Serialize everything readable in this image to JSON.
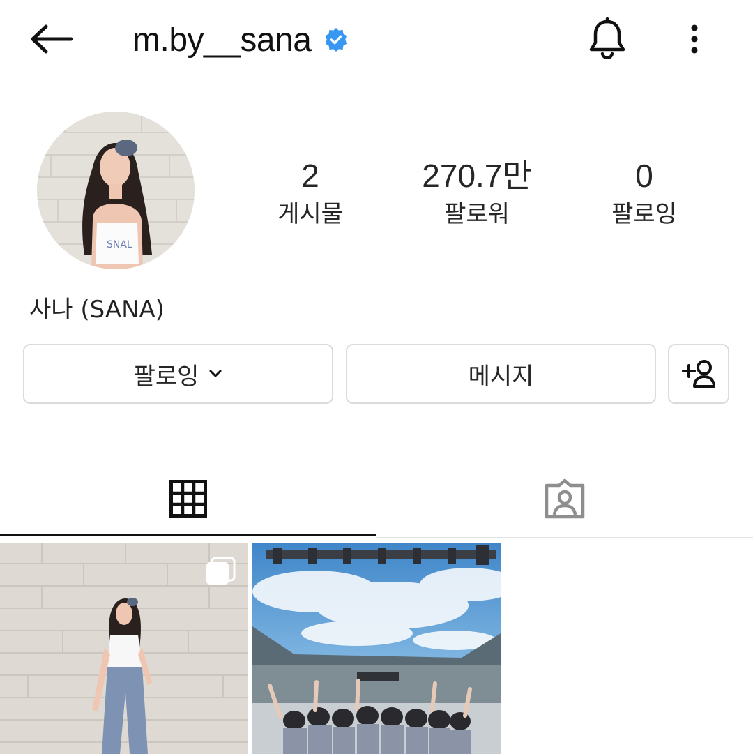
{
  "header": {
    "username": "m.by__sana",
    "verified": true,
    "icons": [
      "back-arrow-icon",
      "verified-badge-icon",
      "bell-icon",
      "more-vertical-icon"
    ]
  },
  "profile": {
    "full_name": "사나 (SANA)",
    "stats": [
      {
        "value": "2",
        "label": "게시물"
      },
      {
        "value": "270.7만",
        "label": "팔로워"
      },
      {
        "value": "0",
        "label": "팔로잉"
      }
    ]
  },
  "actions": {
    "following_label": "팔로잉",
    "message_label": "메시지"
  },
  "tabs": [
    {
      "icon": "grid-icon",
      "active": true
    },
    {
      "icon": "tagged-person-icon",
      "active": false
    }
  ],
  "posts": [
    {
      "kind": "photo",
      "multiple": true
    },
    {
      "kind": "photo",
      "multiple": false
    }
  ],
  "colors": {
    "verified_blue": "#3897f0",
    "border": "#dbdbdb",
    "text": "#262626"
  }
}
